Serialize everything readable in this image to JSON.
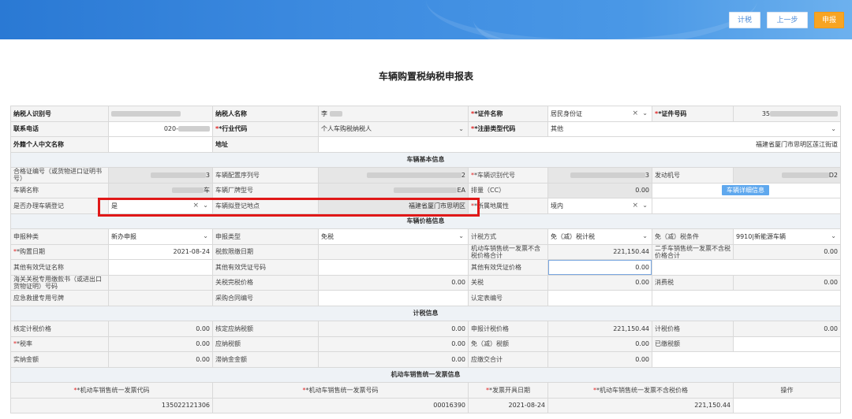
{
  "header": {
    "calc_tax_btn": "计税",
    "prev_btn": "上一步",
    "submit_btn": "申报"
  },
  "title": "车辆购置税纳税申报表",
  "taxpayer": {
    "id_label": "纳税人识别号",
    "name_label": "纳税人名称",
    "name_value": "李",
    "cert_name_label": "*证件名称",
    "cert_name_value": "居民身份证",
    "cert_no_label": "*证件号码",
    "cert_no_value": "35",
    "phone_label": "联系电话",
    "phone_value": "020-",
    "industry_label": "*行业代码",
    "industry_value": "个人车购税纳税人",
    "reg_type_label": "*注册类型代码",
    "reg_type_value": "其他",
    "foreign_name_label": "外籍个人中文名称",
    "address_label": "地址",
    "address_value": "福建省厦门市思明区莲江街道"
  },
  "vehicle": {
    "section": "车辆基本信息",
    "cert_no_label": "合格证编号（或货物进口证明书号）",
    "cert_no_value": "3",
    "config_no_label": "车辆配置序列号",
    "config_no_value": "2",
    "vin_label": "*车辆识别代号",
    "vin_value": "3",
    "engine_label": "发动机号",
    "engine_value": "D2",
    "name_label": "车辆名称",
    "name_value": "车",
    "model_label": "车辆厂牌型号",
    "model_value": "EA",
    "displacement_label": "排量（CC）",
    "displacement_value": "0.00",
    "detail_btn": "车辆详细信息",
    "reg_label": "是否办理车辆登记",
    "reg_value": "是",
    "reg_place_label": "车辆拟登记地点",
    "reg_place_value": "福建省厦门市思明区",
    "attr_label": "*所属地属性",
    "attr_value": "境内"
  },
  "price": {
    "section": "车辆价格信息",
    "decl_type_label": "申报种类",
    "decl_type_value": "新办申报",
    "decl_cat_label": "申报类型",
    "decl_cat_value": "免税",
    "method_label": "计税方式",
    "method_value": "免（减）税计税",
    "cond_label": "免（减）税条件",
    "cond_value": "9910|新能源车辆",
    "buy_date_label": "*购置日期",
    "buy_date_value": "2021-08-24",
    "deadline_label": "税款限缴日期",
    "invoice_total_label": "机动车销售统一发票不含税价格合计",
    "invoice_total_value": "221,150.44",
    "used_total_label": "二手车销售统一发票不含税价格合计",
    "used_total_value": "0.00",
    "other_name_label": "其他有效凭证名称",
    "other_no_label": "其他有效凭证号码",
    "other_price_label": "其他有效凭证价格",
    "other_price_value": "0.00",
    "customs_no_label": "海关关税专用缴款书（或进出口货物证明）号码",
    "customs_price_label": "关税完税价格",
    "customs_price_value": "0.00",
    "tariff_label": "关税",
    "tariff_value": "0.00",
    "consumption_label": "消费税",
    "consumption_value": "0.00",
    "levy_no_label": "应急救援专用号牌",
    "contract_label": "采购合同编号",
    "confirm_label": "认定表编号"
  },
  "tax": {
    "section": "计税信息",
    "verified_price_label": "核定计税价格",
    "verified_price_value": "0.00",
    "verified_tax_label": "核定应纳税额",
    "verified_tax_value": "0.00",
    "decl_price_label": "申报计税价格",
    "decl_price_value": "221,150.44",
    "calc_price_label": "计税价格",
    "calc_price_value": "0.00",
    "rate_label": "*税率",
    "rate_value": "0.00",
    "payable_label": "应纳税额",
    "payable_value": "0.00",
    "exempt_label": "免（减）税额",
    "exempt_value": "0.00",
    "paid_label": "已缴税额",
    "paid_value": "0.00",
    "late_label": "实纳金额",
    "late_value": "0.00",
    "fine_label": "滞纳金金额",
    "fine_value": "0.00",
    "due_label": "应缴交合计",
    "due_value": "0.00"
  },
  "invoice": {
    "section": "机动车销售统一发票信息",
    "columns": [
      "*机动车销售统一发票代码",
      "*机动车销售统一发票号码",
      "*发票开具日期",
      "*机动车销售统一发票不含税价格",
      "操作"
    ],
    "row": {
      "code": "135022121306",
      "number": "00016390",
      "date": "2021-08-24",
      "price": "221,150.44"
    }
  },
  "icons": {
    "dropdown": "chevron-down-icon",
    "clear": "clear-icon"
  },
  "colors": {
    "accent": "#2a79d4",
    "submit": "#f7a423",
    "highlight": "#e01818"
  }
}
